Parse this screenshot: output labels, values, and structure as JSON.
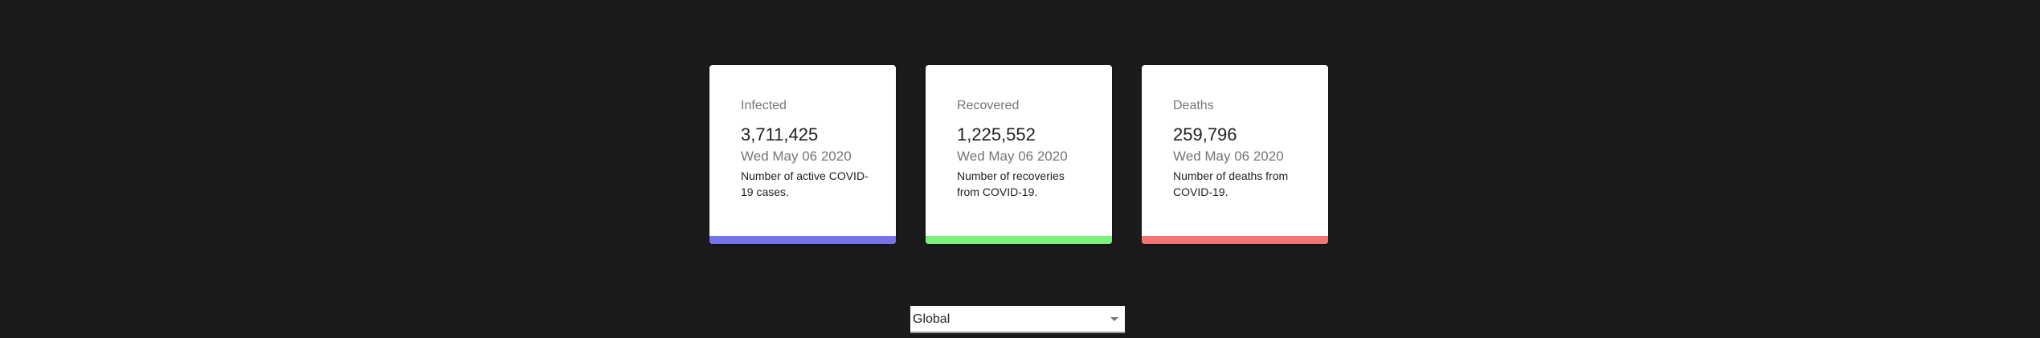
{
  "cards": [
    {
      "title": "Infected",
      "value": "3,711,425",
      "date": "Wed May 06 2020",
      "description": "Number of active COVID-19 cases.",
      "bar_color": "#7373ea"
    },
    {
      "title": "Recovered",
      "value": "1,225,552",
      "date": "Wed May 06 2020",
      "description": "Number of recoveries from COVID-19.",
      "bar_color": "#7cf07c"
    },
    {
      "title": "Deaths",
      "value": "259,796",
      "date": "Wed May 06 2020",
      "description": "Number of deaths from COVID-19.",
      "bar_color": "#f27474"
    }
  ],
  "country_select": {
    "selected": "Global",
    "icon": "chevron-down-icon"
  }
}
